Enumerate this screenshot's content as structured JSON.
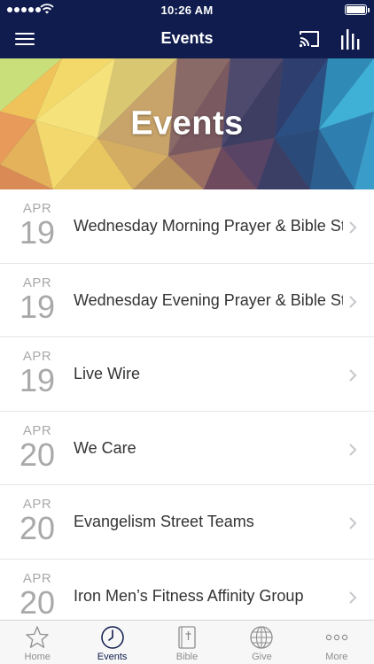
{
  "status_bar": {
    "time": "10:26 AM"
  },
  "nav": {
    "title": "Events"
  },
  "banner": {
    "title": "Events"
  },
  "events": [
    {
      "month": "APR",
      "day": "19",
      "name": "Wednesday Morning Prayer & Bible Study"
    },
    {
      "month": "APR",
      "day": "19",
      "name": "Wednesday Evening Prayer & Bible Study"
    },
    {
      "month": "APR",
      "day": "19",
      "name": "Live Wire"
    },
    {
      "month": "APR",
      "day": "20",
      "name": "We Care"
    },
    {
      "month": "APR",
      "day": "20",
      "name": "Evangelism Street Teams"
    },
    {
      "month": "APR",
      "day": "20",
      "name": "Iron Men’s Fitness Affinity Group"
    }
  ],
  "tabs": [
    {
      "label": "Home",
      "icon": "star-icon",
      "active": false
    },
    {
      "label": "Events",
      "icon": "clock-icon",
      "active": true
    },
    {
      "label": "Bible",
      "icon": "bible-icon",
      "active": false
    },
    {
      "label": "Give",
      "icon": "globe-icon",
      "active": false
    },
    {
      "label": "More",
      "icon": "more-icon",
      "active": false
    }
  ],
  "colors": {
    "nav_background": "#0f1c4d",
    "active_tab": "#0f1c4d",
    "inactive_tab": "#8e8e8e",
    "date_text": "#a9a9a9"
  }
}
